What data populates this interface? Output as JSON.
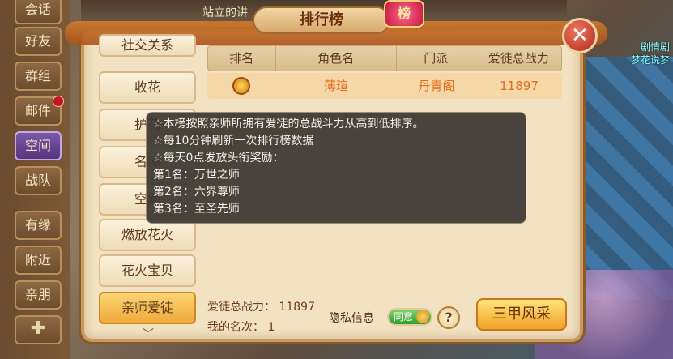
{
  "background": {
    "topbar_text": "站立的讲",
    "right_label_line1": "剧情剧",
    "right_label_line2": "梦花说梦"
  },
  "sidemenu": {
    "items": [
      {
        "label": "会话"
      },
      {
        "label": "好友"
      },
      {
        "label": "群组"
      },
      {
        "label": "邮件"
      },
      {
        "label": "空间"
      },
      {
        "label": "战队"
      },
      {
        "label": "有缘"
      },
      {
        "label": "附近"
      },
      {
        "label": "亲朋"
      }
    ]
  },
  "panel": {
    "title": "排行榜",
    "badge": "榜",
    "close_glyph": "✕"
  },
  "categories": {
    "items": [
      {
        "label": "社交关系"
      },
      {
        "label": "收花"
      },
      {
        "label": "护花"
      },
      {
        "label": "名师"
      },
      {
        "label": "空间"
      },
      {
        "label": "燃放花火"
      },
      {
        "label": "花火宝贝"
      },
      {
        "label": "亲师爱徒"
      }
    ],
    "up_glyph": "︿",
    "down_glyph": "﹀"
  },
  "table": {
    "headers": [
      "排名",
      "角色名",
      "门派",
      "爱徒总战力"
    ],
    "rows": [
      {
        "name": "薄瑄",
        "school": "丹青阁",
        "power": "11897"
      }
    ]
  },
  "tooltip": {
    "lines": [
      "☆本榜按照亲师所拥有爱徒的总战斗力从高到低排序。",
      "☆每10分钟刷新一次排行榜数据",
      "☆每天0点发放头衔奖励：",
      "第1名：万世之师",
      "第2名：六界尊师",
      "第3名：至圣先师"
    ]
  },
  "footer": {
    "power_label": "爱徒总战力：",
    "power_value": "11897",
    "rank_label": "我的名次：",
    "rank_value": "1",
    "privacy_label": "隐私信息",
    "toggle_label": "同意",
    "help_glyph": "?",
    "action_button": "三甲风采"
  }
}
